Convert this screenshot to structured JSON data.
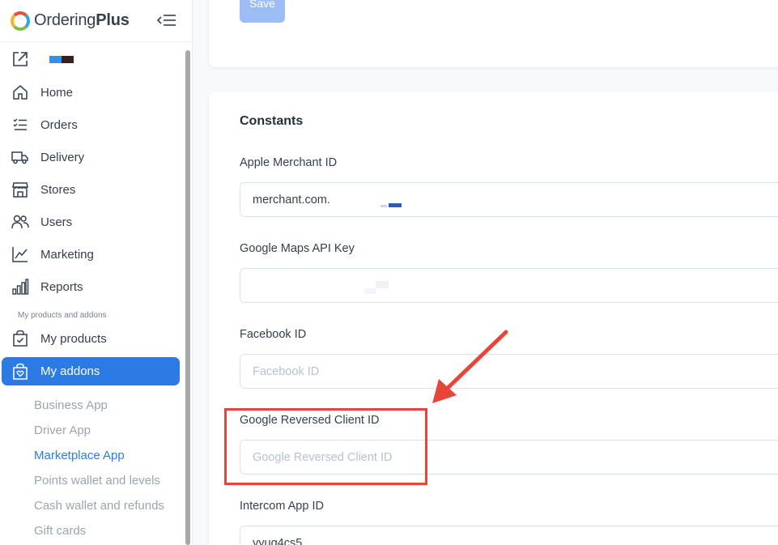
{
  "brand": {
    "name_light": "Ordering",
    "name_bold": "Plus"
  },
  "sidebar": {
    "nav": [
      {
        "label": "Home",
        "icon": "home-icon"
      },
      {
        "label": "Orders",
        "icon": "list-icon"
      },
      {
        "label": "Delivery",
        "icon": "truck-icon"
      },
      {
        "label": "Stores",
        "icon": "shop-icon"
      },
      {
        "label": "Users",
        "icon": "users-icon"
      },
      {
        "label": "Marketing",
        "icon": "chart-line-icon"
      },
      {
        "label": "Reports",
        "icon": "bar-chart-icon"
      }
    ],
    "section_label": "My products and addons",
    "products_label": "My products",
    "addons_label": "My addons",
    "subitems": [
      {
        "label": "Business App"
      },
      {
        "label": "Driver App"
      },
      {
        "label": "Marketplace App"
      },
      {
        "label": "Points wallet and levels"
      },
      {
        "label": "Cash wallet and refunds"
      },
      {
        "label": "Gift cards"
      }
    ]
  },
  "top_card": {
    "save_label": "Save"
  },
  "constants": {
    "title": "Constants",
    "fields": [
      {
        "label": "Apple Merchant ID",
        "value": "merchant.com.",
        "placeholder": ""
      },
      {
        "label": "Google Maps API Key",
        "value": "",
        "placeholder": ""
      },
      {
        "label": "Facebook ID",
        "value": "",
        "placeholder": "Facebook ID"
      },
      {
        "label": "Google Reversed Client ID",
        "value": "",
        "placeholder": "Google Reversed Client ID"
      },
      {
        "label": "Intercom App ID",
        "value": "yyug4cs5",
        "placeholder": ""
      }
    ]
  },
  "colors": {
    "accent": "#2c7be5",
    "annotation": "#e8443a"
  }
}
